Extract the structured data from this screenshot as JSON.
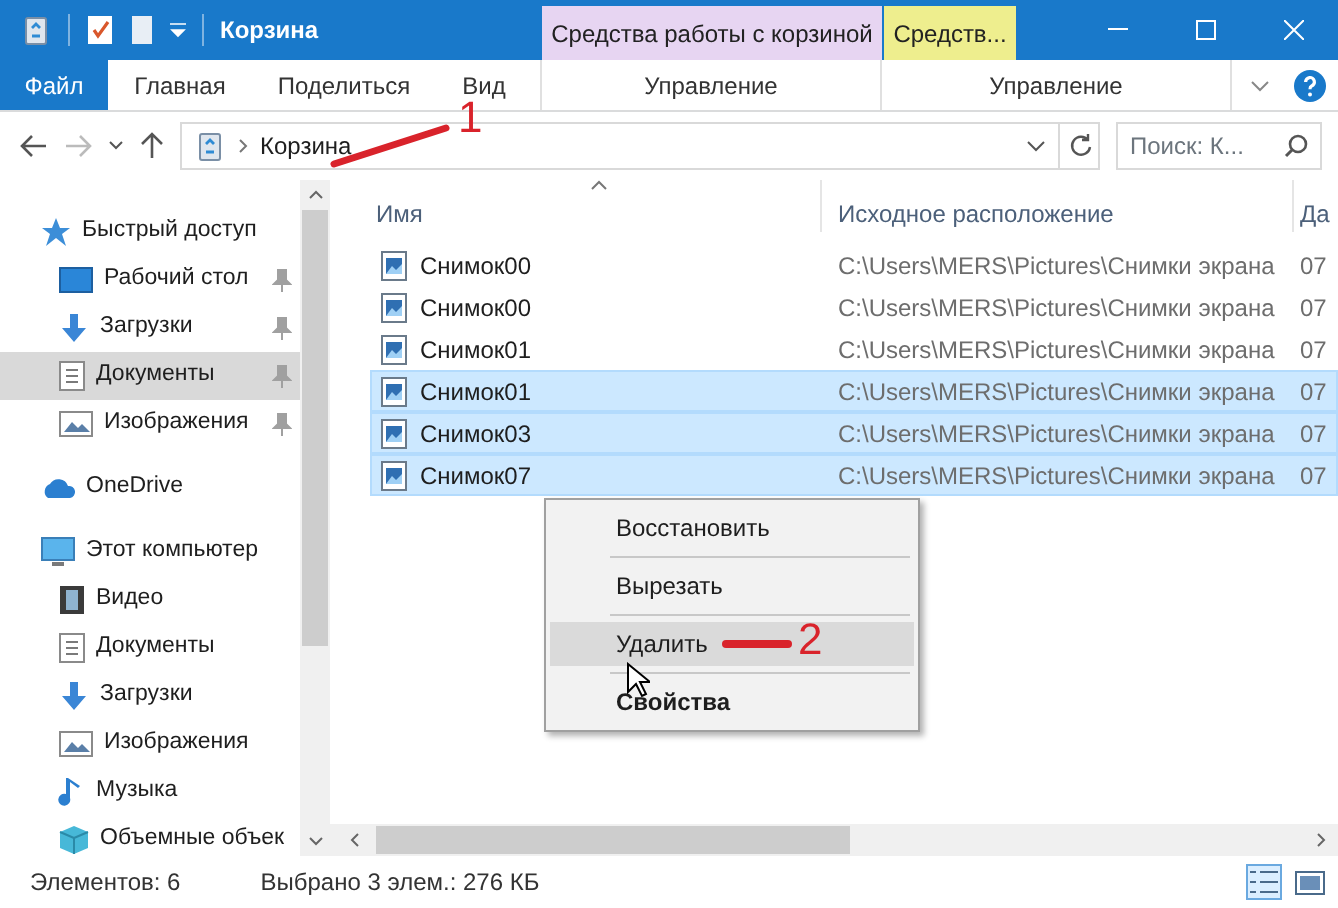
{
  "window": {
    "title": "Корзина"
  },
  "contextual_groups": [
    {
      "label": "Средства работы с корзиной",
      "color": "#e7d5f2"
    },
    {
      "label": "Средств...",
      "color": "#eeee8e"
    }
  ],
  "ribbon_tabs": [
    {
      "label": "Файл",
      "kind": "file"
    },
    {
      "label": "Главная",
      "kind": "tab"
    },
    {
      "label": "Поделиться",
      "kind": "tab"
    },
    {
      "label": "Вид",
      "kind": "tab"
    },
    {
      "label": "Управление",
      "kind": "contextual"
    },
    {
      "label": "Управление",
      "kind": "contextual"
    }
  ],
  "address_bar": {
    "path": "Корзина",
    "search_placeholder": "Поиск: К..."
  },
  "nav_pane": {
    "items": [
      {
        "label": "Быстрый доступ",
        "selected": false,
        "children": [
          {
            "label": "Рабочий стол",
            "pinned": true,
            "selected": false
          },
          {
            "label": "Загрузки",
            "pinned": true,
            "selected": false
          },
          {
            "label": "Документы",
            "pinned": true,
            "selected": true
          },
          {
            "label": "Изображения",
            "pinned": true,
            "selected": false
          }
        ]
      },
      {
        "label": "OneDrive",
        "selected": false
      },
      {
        "label": "Этот компьютер",
        "selected": false,
        "children": [
          {
            "label": "Видео",
            "selected": false
          },
          {
            "label": "Документы",
            "selected": false
          },
          {
            "label": "Загрузки",
            "selected": false
          },
          {
            "label": "Изображения",
            "selected": false
          },
          {
            "label": "Музыка",
            "selected": false
          },
          {
            "label": "Объемные объек",
            "selected": false
          }
        ]
      }
    ]
  },
  "file_list": {
    "columns": [
      "Имя",
      "Исходное расположение",
      "Да"
    ],
    "rows": [
      {
        "name": "Снимок00",
        "location": "C:\\Users\\MERS\\Pictures\\Снимки экрана",
        "date": "07",
        "selected": false
      },
      {
        "name": "Снимок00",
        "location": "C:\\Users\\MERS\\Pictures\\Снимки экрана",
        "date": "07",
        "selected": false
      },
      {
        "name": "Снимок01",
        "location": "C:\\Users\\MERS\\Pictures\\Снимки экрана",
        "date": "07",
        "selected": false
      },
      {
        "name": "Снимок01",
        "location": "C:\\Users\\MERS\\Pictures\\Снимки экрана",
        "date": "07",
        "selected": true
      },
      {
        "name": "Снимок03",
        "location": "C:\\Users\\MERS\\Pictures\\Снимки экрана",
        "date": "07",
        "selected": true
      },
      {
        "name": "Снимок07",
        "location": "C:\\Users\\MERS\\Pictures\\Снимки экрана",
        "date": "07",
        "selected": true
      }
    ]
  },
  "context_menu": {
    "items": [
      {
        "kind": "item",
        "label": "Восстановить",
        "hovered": false,
        "is_default": false
      },
      {
        "kind": "separator"
      },
      {
        "kind": "item",
        "label": "Вырезать",
        "hovered": false,
        "is_default": false
      },
      {
        "kind": "separator"
      },
      {
        "kind": "item",
        "label": "Удалить",
        "hovered": true,
        "is_default": false
      },
      {
        "kind": "separator"
      },
      {
        "kind": "item",
        "label": "Свойства",
        "hovered": false,
        "is_default": true
      }
    ]
  },
  "annotations": [
    {
      "label": "1"
    },
    {
      "label": "2"
    }
  ],
  "status_bar": {
    "item_count": "Элементов: 6",
    "selection": "Выбрано 3 элем.: 276 КБ",
    "views": [
      {
        "selected": true
      },
      {
        "selected": false
      }
    ]
  }
}
